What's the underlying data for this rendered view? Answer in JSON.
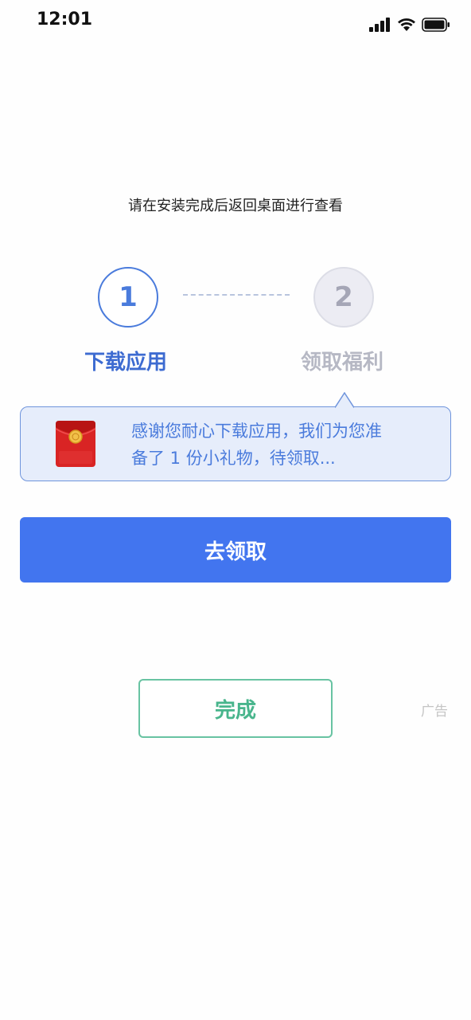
{
  "status_bar": {
    "time": "12:01",
    "icons": [
      "cellular-signal-icon",
      "wifi-icon",
      "battery-icon"
    ]
  },
  "instruction": "请在安装完成后返回桌面进行查看",
  "steps": [
    {
      "number": "1",
      "label": "下载应用",
      "state": "active"
    },
    {
      "number": "2",
      "label": "领取福利",
      "state": "inactive"
    }
  ],
  "callout": {
    "icon": "red-envelope-gift-icon",
    "line1": "感谢您耐心下载应用，我们为您准",
    "line2": "备了 1 份小礼物，待领取..."
  },
  "primary_button": "去领取",
  "done_button": "完成",
  "ad_label": "广告",
  "colors": {
    "accent_blue": "#4275ef",
    "step_blue": "#4a7bdc",
    "done_green": "#48b58c",
    "callout_bg": "#e6edfb"
  }
}
